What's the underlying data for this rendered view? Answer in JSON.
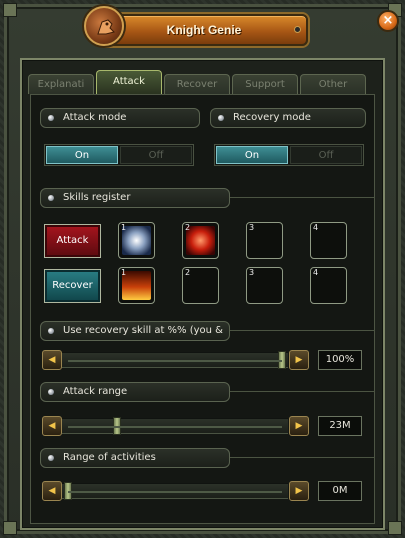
{
  "window": {
    "title": "Knight Genie",
    "close_label": "×"
  },
  "tabs": [
    {
      "label": "Explanati"
    },
    {
      "label": "Attack"
    },
    {
      "label": "Recover"
    },
    {
      "label": "Support"
    },
    {
      "label": "Other"
    }
  ],
  "active_tab": "Attack",
  "attack_mode": {
    "label": "Attack mode",
    "on_label": "On",
    "off_label": "Off",
    "selected": "On"
  },
  "recovery_mode": {
    "label": "Recovery mode",
    "on_label": "On",
    "off_label": "Off",
    "selected": "On"
  },
  "skills_register": {
    "label": "Skills register",
    "attack_button": "Attack",
    "recover_button": "Recover",
    "attack_slots": [
      {
        "num": "1",
        "icon": "tiger-skill-icon"
      },
      {
        "num": "2",
        "icon": "red-spiral-skill-icon"
      },
      {
        "num": "3",
        "icon": ""
      },
      {
        "num": "4",
        "icon": ""
      }
    ],
    "recover_slots": [
      {
        "num": "1",
        "icon": "fire-potion-skill-icon"
      },
      {
        "num": "2",
        "icon": ""
      },
      {
        "num": "3",
        "icon": ""
      },
      {
        "num": "4",
        "icon": ""
      }
    ]
  },
  "recovery_skill_threshold": {
    "label": "Use recovery skill at %% (you &",
    "value_text": "100%",
    "fraction": 1.0
  },
  "attack_range": {
    "label": "Attack range",
    "value_text": "23M",
    "fraction": 0.23
  },
  "range_of_activities": {
    "label": "Range of activities",
    "value_text": "0M",
    "fraction": 0.0
  },
  "colors": {
    "accent_orange": "#a85715",
    "toggle_on": "#1f5a60",
    "attack_red": "#a8151e",
    "recover_teal": "#2a7f86"
  }
}
